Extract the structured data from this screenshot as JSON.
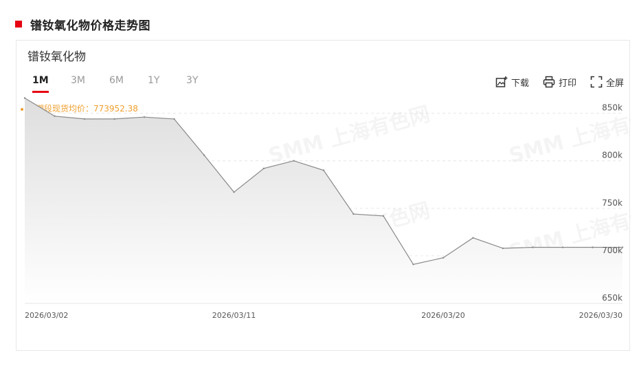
{
  "section": {
    "title": "镨钕氧化物价格走势图"
  },
  "card": {
    "title": "镨钕氧化物"
  },
  "tabs": [
    {
      "label": "1M",
      "active": true
    },
    {
      "label": "3M",
      "active": false
    },
    {
      "label": "6M",
      "active": false
    },
    {
      "label": "1Y",
      "active": false
    },
    {
      "label": "3Y",
      "active": false
    }
  ],
  "toolbar": {
    "download_label": "下载",
    "print_label": "打印",
    "fullscreen_label": "全屏"
  },
  "avg": {
    "text": "日期段现货均价：773952.38"
  },
  "watermark": {
    "text": "SMM 上海有色网"
  },
  "colors": {
    "accent": "#e60012",
    "avg": "#f0a030",
    "line": "#888888"
  },
  "chart_data": {
    "type": "area",
    "title": "",
    "xlabel": "",
    "ylabel": "",
    "ylim": [
      650000,
      870000
    ],
    "y_ticks": [
      650000,
      700000,
      750000,
      800000,
      850000
    ],
    "y_tick_labels": [
      "650k",
      "700k",
      "750k",
      "800k",
      "850k"
    ],
    "x_tick_labels": [
      "2026/03/02",
      "2026/03/11",
      "2026/03/20",
      "2026/03/30"
    ],
    "grid": true,
    "average": 773952.38,
    "series": [
      {
        "x": [
          "2026/03/02",
          "2026/03/03",
          "2026/03/04",
          "2026/03/05",
          "2026/03/06",
          "2026/03/09",
          "2026/03/10",
          "2026/03/11",
          "2026/03/12",
          "2026/03/13",
          "2026/03/16",
          "2026/03/17",
          "2026/03/18",
          "2026/03/19",
          "2026/03/20",
          "2026/03/23",
          "2026/03/24",
          "2026/03/25",
          "2026/03/26",
          "2026/03/27",
          "2026/03/30"
        ],
        "values": [
          866000,
          847000,
          844000,
          844000,
          846000,
          844000,
          806000,
          767000,
          792000,
          800000,
          790000,
          744000,
          742000,
          691000,
          698000,
          719000,
          708000,
          709000,
          709000,
          709000,
          709000
        ]
      }
    ]
  }
}
